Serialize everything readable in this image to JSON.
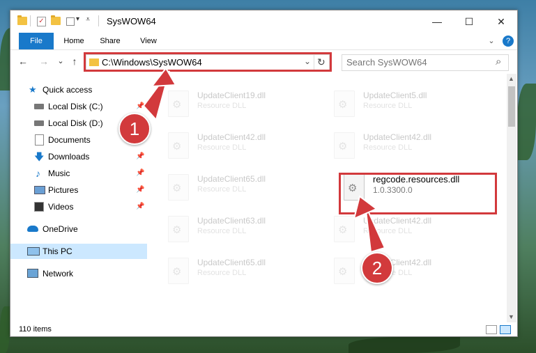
{
  "window": {
    "title": "SysWOW64",
    "controls": {
      "minimize": "—",
      "maximize": "☐",
      "close": "✕"
    }
  },
  "ribbon": {
    "tabs": [
      "File",
      "Home",
      "Share",
      "View"
    ],
    "collapse_icon": "⌄",
    "help_icon": "?"
  },
  "address": {
    "path": "C:\\Windows\\SysWOW64",
    "dropdown_icon": "⌄",
    "refresh_icon": "↻"
  },
  "search": {
    "placeholder": "Search SysWOW64",
    "icon": "⌕"
  },
  "nav_buttons": {
    "back": "←",
    "forward": "→",
    "recent": "⌄",
    "up": "↑"
  },
  "nav_pane": {
    "quick_access": "Quick access",
    "items": [
      {
        "label": "Local Disk (C:)",
        "icon": "drive-icon",
        "pinned": true
      },
      {
        "label": "Local Disk (D:)",
        "icon": "drive-icon",
        "pinned": false
      },
      {
        "label": "Documents",
        "icon": "documents-icon",
        "pinned": true
      },
      {
        "label": "Downloads",
        "icon": "downloads-icon",
        "pinned": true
      },
      {
        "label": "Music",
        "icon": "music-icon",
        "pinned": true
      },
      {
        "label": "Pictures",
        "icon": "pictures-icon",
        "pinned": true
      },
      {
        "label": "Videos",
        "icon": "videos-icon",
        "pinned": true
      }
    ],
    "onedrive": "OneDrive",
    "this_pc": "This PC",
    "network": "Network",
    "pin_icon": "📌"
  },
  "files": [
    {
      "name": "UpdateClient19.dll",
      "sub": "Resource DLL"
    },
    {
      "name": "UpdateClient5.dll",
      "sub": "Resource DLL"
    },
    {
      "name": "UpdateClient42.dll",
      "sub": "Resource DLL"
    },
    {
      "name": "UpdateClient42.dll",
      "sub": "Resource DLL"
    },
    {
      "name": "UpdateClient65.dll",
      "sub": "Resource DLL"
    },
    {
      "name": "regcode.resources.dll",
      "sub": "1.0.3300.0"
    },
    {
      "name": "UpdateClient63.dll",
      "sub": "Resource DLL"
    },
    {
      "name": "UpdateClient42.dll",
      "sub": "Resource DLL"
    },
    {
      "name": "UpdateClient65.dll",
      "sub": "Resource DLL"
    },
    {
      "name": "UpdateClient42.dll",
      "sub": "Resource DLL"
    }
  ],
  "status": {
    "count": "110 items"
  },
  "callouts": [
    "1",
    "2"
  ],
  "colors": {
    "accent": "#1979ca",
    "highlight": "#d2393c",
    "selection": "#cce8ff"
  }
}
